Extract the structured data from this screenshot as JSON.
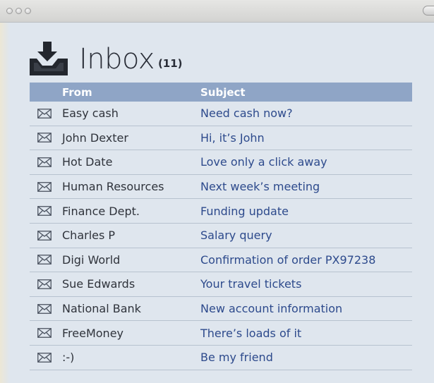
{
  "window": {
    "traffic_lights": [
      "close",
      "minimize",
      "zoom"
    ]
  },
  "header": {
    "title": "Inbox",
    "count": "(11)",
    "icon": "inbox-tray-icon"
  },
  "table": {
    "columns": [
      "From",
      "Subject"
    ],
    "rows": [
      {
        "from": "Easy cash",
        "subject": "Need cash now?"
      },
      {
        "from": "John Dexter",
        "subject": "Hi, it’s John"
      },
      {
        "from": "Hot Date",
        "subject": "Love only a click away"
      },
      {
        "from": "Human Resources",
        "subject": "Next week’s meeting"
      },
      {
        "from": "Finance Dept.",
        "subject": "Funding update"
      },
      {
        "from": "Charles P",
        "subject": "Salary query"
      },
      {
        "from": "Digi World",
        "subject": "Confirmation of order PX97238"
      },
      {
        "from": "Sue Edwards",
        "subject": "Your travel tickets"
      },
      {
        "from": "National Bank",
        "subject": "New account information"
      },
      {
        "from": "FreeMoney",
        "subject": "There’s loads of it"
      },
      {
        "from": ":-)",
        "subject": "Be my friend"
      }
    ]
  },
  "colors": {
    "header_bar": "#8fa5c6",
    "window_bg": "#dfe6ee",
    "subject_text": "#2d4a8c"
  }
}
